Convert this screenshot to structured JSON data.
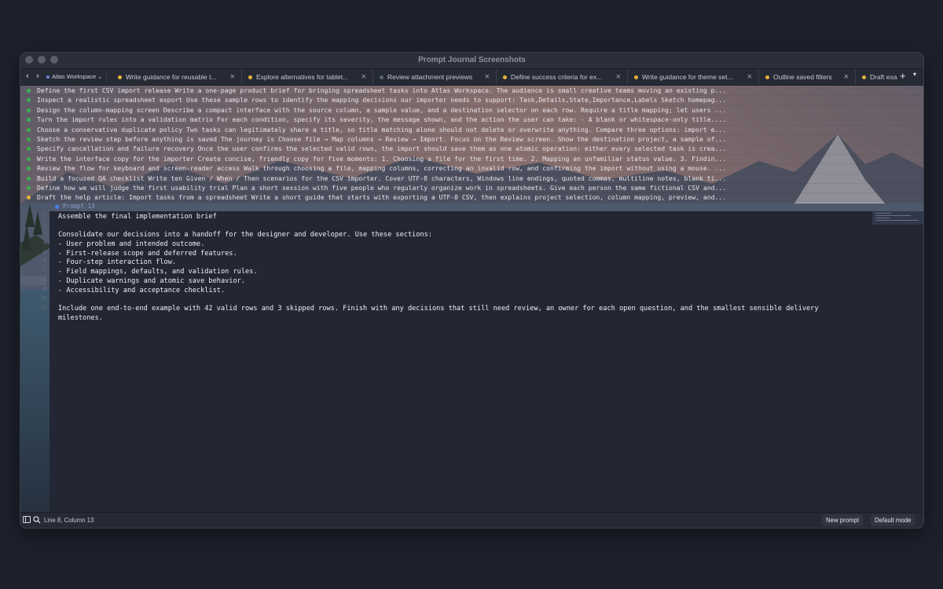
{
  "window": {
    "title": "Prompt Journal Screenshots"
  },
  "tabbar": {
    "project": "Atlas Workspace",
    "tabs": [
      {
        "label": "Write guidance for reusable t...",
        "dot": "#e8b33a"
      },
      {
        "label": "Explore alternatives for tablet...",
        "dot": "#e8b33a"
      },
      {
        "label": "Review attachment previews",
        "dot": "#5d6474"
      },
      {
        "label": "Define success criteria for ex...",
        "dot": "#e8b33a"
      },
      {
        "label": "Write guidance for theme set...",
        "dot": "#e8b33a"
      },
      {
        "label": "Outline saved filters",
        "dot": "#e8b33a"
      },
      {
        "label": "Draft exa",
        "dot": "#e8b33a"
      }
    ]
  },
  "list": {
    "items": [
      {
        "text": "Define the first CSV import release Write a one-page product brief for bringing spreadsheet tasks into Atlas Workspace. The audience is small creative teams moving an existing p...",
        "dot": "#3cb050"
      },
      {
        "text": "Inspect a realistic spreadsheet export Use these sample rows to identify the mapping decisions our importer needs to support: Task,Details,State,Importance,Labels Sketch homepag...",
        "dot": "#3cb050"
      },
      {
        "text": "Design the column-mapping screen Describe a compact interface with the source column, a sample value, and a destination selector on each row. Require a title mapping; let users ...",
        "dot": "#3cb050"
      },
      {
        "text": "Turn the import rules into a validation matrix For each condition, specify its severity, the message shown, and the action the user can take: - A blank or whitespace-only title....",
        "dot": "#3cb050"
      },
      {
        "text": "Choose a conservative duplicate policy Two tasks can legitimately share a title, so title matching alone should not delete or overwrite anything. Compare three options: import e...",
        "dot": "#3cb050"
      },
      {
        "text": "Sketch the review step before anything is saved The journey is Choose file → Map columns → Review → Import. Focus on the Review screen. Show the destination project, a sample of...",
        "dot": "#3cb050"
      },
      {
        "text": "Specify cancellation and failure recovery Once the user confirms the selected valid rows, the import should save them as one atomic operation: either every selected task is crea...",
        "dot": "#3cb050"
      },
      {
        "text": "Write the interface copy for the importer Create concise, friendly copy for five moments: 1. Choosing a file for the first time. 2. Mapping an unfamiliar status value. 3. Findin...",
        "dot": "#3cb050"
      },
      {
        "text": "Review the flow for keyboard and screen-reader access Walk through choosing a file, mapping columns, correcting an invalid row, and confirming the import without using a mouse. ...",
        "dot": "#3cb050"
      },
      {
        "text": "Build a focused QA checklist Write ten Given / When / Then scenarios for the CSV importer. Cover UTF-8 characters, Windows line endings, quoted commas, multiline notes, blank ti...",
        "dot": "#3cb050"
      },
      {
        "text": "Define how we will judge the first usability trial Plan a short session with five people who regularly organize work in spreadsheets. Give each person the same fictional CSV and...",
        "dot": "#3cb050"
      },
      {
        "text": "Draft the help article: Import tasks from a spreadsheet Write a short guide that starts with exporting a UTF-8 CSV, then explains project selection, column mapping, preview, and...",
        "dot": "#e8b33a"
      }
    ]
  },
  "editor": {
    "prompt_label": "Prompt 13",
    "line_numbers": [
      "1",
      "2",
      "3",
      "4",
      "5",
      "6",
      "7",
      "8",
      "9",
      "10",
      "11"
    ],
    "lines": [
      "Assemble the final implementation brief",
      "",
      "Consolidate our decisions into a handoff for the designer and developer. Use these sections:",
      "- User problem and intended outcome.",
      "- First-release scope and deferred features.",
      "- Four-step interaction flow.",
      "- Field mappings, defaults, and validation rules.",
      "- Duplicate warnings and atomic save behavior.",
      "- Accessibility and acceptance checklist.",
      "",
      "Include one end-to-end example with 42 valid rows and 3 skipped rows. Finish with any decisions that still need review, an owner for each open question, and the smallest sensible delivery",
      "milestones."
    ]
  },
  "status": {
    "position": "Line 8, Column 13",
    "new_prompt": "New prompt",
    "mode": "Default mode"
  }
}
